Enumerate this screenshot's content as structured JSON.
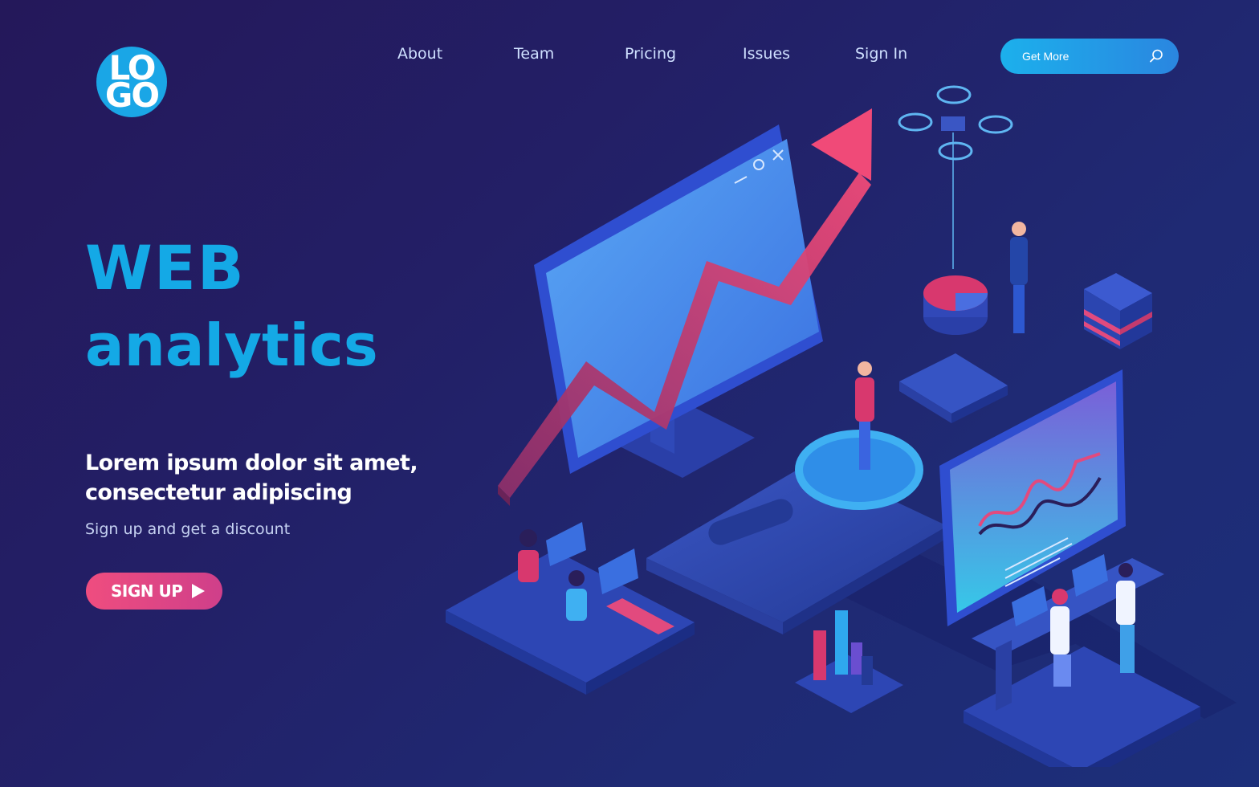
{
  "logo": {
    "line1": "LO",
    "line2": "GO"
  },
  "nav": [
    {
      "label": "About"
    },
    {
      "label": "Team"
    },
    {
      "label": "Pricing"
    },
    {
      "label": "Issues"
    },
    {
      "label": "Sign In"
    }
  ],
  "search": {
    "label": "Get More",
    "icon": "search-icon"
  },
  "hero": {
    "title_line1": "WEB",
    "title_line2": "analytics",
    "subtitle_line1": "Lorem ipsum dolor sit amet,",
    "subtitle_line2": "consectetur adipiscing",
    "discount": "Sign up and get a discount",
    "cta_label": "SIGN UP",
    "cta_icon": "play-icon"
  },
  "colors": {
    "accent_blue": "#14a9e6",
    "accent_pink": "#ef4d7f",
    "background": "#231f66"
  }
}
